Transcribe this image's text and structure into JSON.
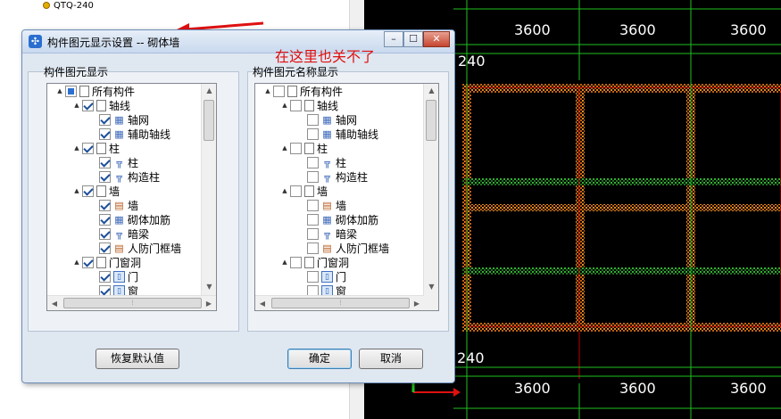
{
  "left_panel": {
    "tree_item": "QTQ-240"
  },
  "canvas": {
    "top_dims": [
      "3600",
      "3600",
      "3600"
    ],
    "bottom_dims": [
      "3600",
      "3600",
      "3600"
    ],
    "left_top_dim": "240",
    "left_bottom_dim": "240",
    "colors": {
      "background": "#000000",
      "gridline": "#20c020",
      "wall_hatch": "#e08a20",
      "axis_red": "#e01010",
      "beam_red": "#c00000"
    }
  },
  "dialog": {
    "title": "构件图元显示设置 -- 砌体墙",
    "minimize_glyph": "–",
    "maximize_glyph": "☐",
    "close_glyph": "✕",
    "left_group": "构件图元显示",
    "right_group": "构件图元名称显示",
    "restore_button": "恢复默认值",
    "ok_button": "确定",
    "cancel_button": "取消"
  },
  "annotation": "在这里也关不了",
  "left_tree": [
    {
      "label": "所有构件",
      "level": 0,
      "expander": "▲",
      "check": "part",
      "icon": "doc"
    },
    {
      "label": "轴线",
      "level": 1,
      "expander": "▲",
      "check": "on",
      "icon": "doc"
    },
    {
      "label": "轴网",
      "level": 2,
      "expander": "",
      "check": "on",
      "icon": "grid"
    },
    {
      "label": "辅助轴线",
      "level": 2,
      "expander": "",
      "check": "on",
      "icon": "grid"
    },
    {
      "label": "柱",
      "level": 1,
      "expander": "▲",
      "check": "on",
      "icon": "doc"
    },
    {
      "label": "柱",
      "level": 2,
      "expander": "",
      "check": "on",
      "icon": "col"
    },
    {
      "label": "构造柱",
      "level": 2,
      "expander": "",
      "check": "on",
      "icon": "col"
    },
    {
      "label": "墙",
      "level": 1,
      "expander": "▲",
      "check": "on",
      "icon": "doc"
    },
    {
      "label": "墙",
      "level": 2,
      "expander": "",
      "check": "on",
      "icon": "wall"
    },
    {
      "label": "砌体加筋",
      "level": 2,
      "expander": "",
      "check": "on",
      "icon": "grid"
    },
    {
      "label": "暗梁",
      "level": 2,
      "expander": "",
      "check": "on",
      "icon": "col"
    },
    {
      "label": "人防门框墙",
      "level": 2,
      "expander": "",
      "check": "on",
      "icon": "wall"
    },
    {
      "label": "门窗洞",
      "level": 1,
      "expander": "▲",
      "check": "on",
      "icon": "doc"
    },
    {
      "label": "门",
      "level": 2,
      "expander": "",
      "check": "on",
      "icon": "door"
    },
    {
      "label": "窗",
      "level": 2,
      "expander": "",
      "check": "on",
      "icon": "door"
    },
    {
      "label": "门联窗",
      "level": 2,
      "expander": "",
      "check": "on",
      "icon": "door"
    }
  ],
  "right_tree": [
    {
      "label": "所有构件",
      "level": 0,
      "expander": "▲",
      "check": "off",
      "icon": "doc"
    },
    {
      "label": "轴线",
      "level": 1,
      "expander": "▲",
      "check": "off",
      "icon": "doc"
    },
    {
      "label": "轴网",
      "level": 2,
      "expander": "",
      "check": "off",
      "icon": "grid"
    },
    {
      "label": "辅助轴线",
      "level": 2,
      "expander": "",
      "check": "off",
      "icon": "grid"
    },
    {
      "label": "柱",
      "level": 1,
      "expander": "▲",
      "check": "off",
      "icon": "doc"
    },
    {
      "label": "柱",
      "level": 2,
      "expander": "",
      "check": "off",
      "icon": "col"
    },
    {
      "label": "构造柱",
      "level": 2,
      "expander": "",
      "check": "off",
      "icon": "col"
    },
    {
      "label": "墙",
      "level": 1,
      "expander": "▲",
      "check": "off",
      "icon": "doc"
    },
    {
      "label": "墙",
      "level": 2,
      "expander": "",
      "check": "off",
      "icon": "wall"
    },
    {
      "label": "砌体加筋",
      "level": 2,
      "expander": "",
      "check": "off",
      "icon": "grid"
    },
    {
      "label": "暗梁",
      "level": 2,
      "expander": "",
      "check": "off",
      "icon": "col"
    },
    {
      "label": "人防门框墙",
      "level": 2,
      "expander": "",
      "check": "off",
      "icon": "wall"
    },
    {
      "label": "门窗洞",
      "level": 1,
      "expander": "▲",
      "check": "off",
      "icon": "doc"
    },
    {
      "label": "门",
      "level": 2,
      "expander": "",
      "check": "off",
      "icon": "door"
    },
    {
      "label": "窗",
      "level": 2,
      "expander": "",
      "check": "off",
      "icon": "door"
    },
    {
      "label": "门联窗",
      "level": 2,
      "expander": "",
      "check": "off",
      "icon": "door"
    }
  ],
  "icons": {
    "grid": "▦",
    "col": "╦",
    "wall": "▤",
    "door": "▯",
    "doc": ""
  }
}
